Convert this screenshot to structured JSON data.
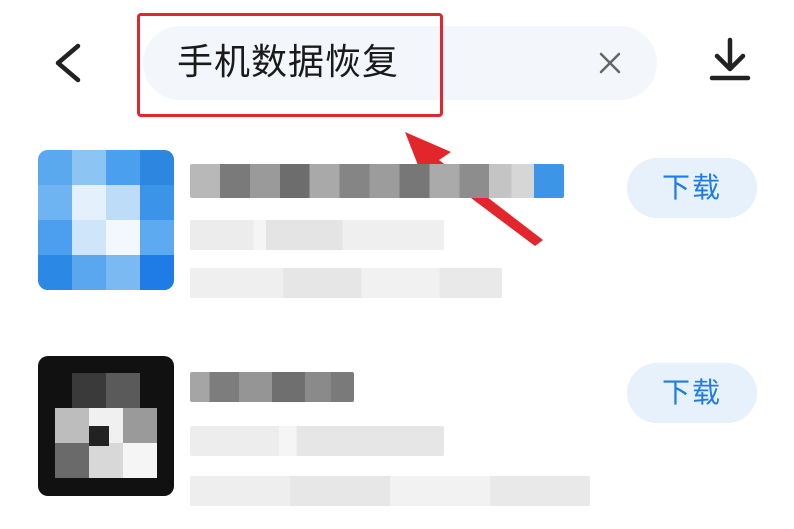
{
  "header": {
    "back_icon": "chevron-left-icon",
    "search_query": "手机数据恢复",
    "clear_icon": "close-icon",
    "download_manager_icon": "download-icon"
  },
  "annotation": {
    "highlight_color": "#e3262b"
  },
  "results": [
    {
      "button_label": "下载",
      "icon_color": "#2f8fe8"
    },
    {
      "button_label": "下载",
      "icon_color": "#111111"
    }
  ],
  "colors": {
    "accent": "#1f7be6",
    "button_bg": "#e7f1fb",
    "search_bg": "#f3f6fa"
  }
}
